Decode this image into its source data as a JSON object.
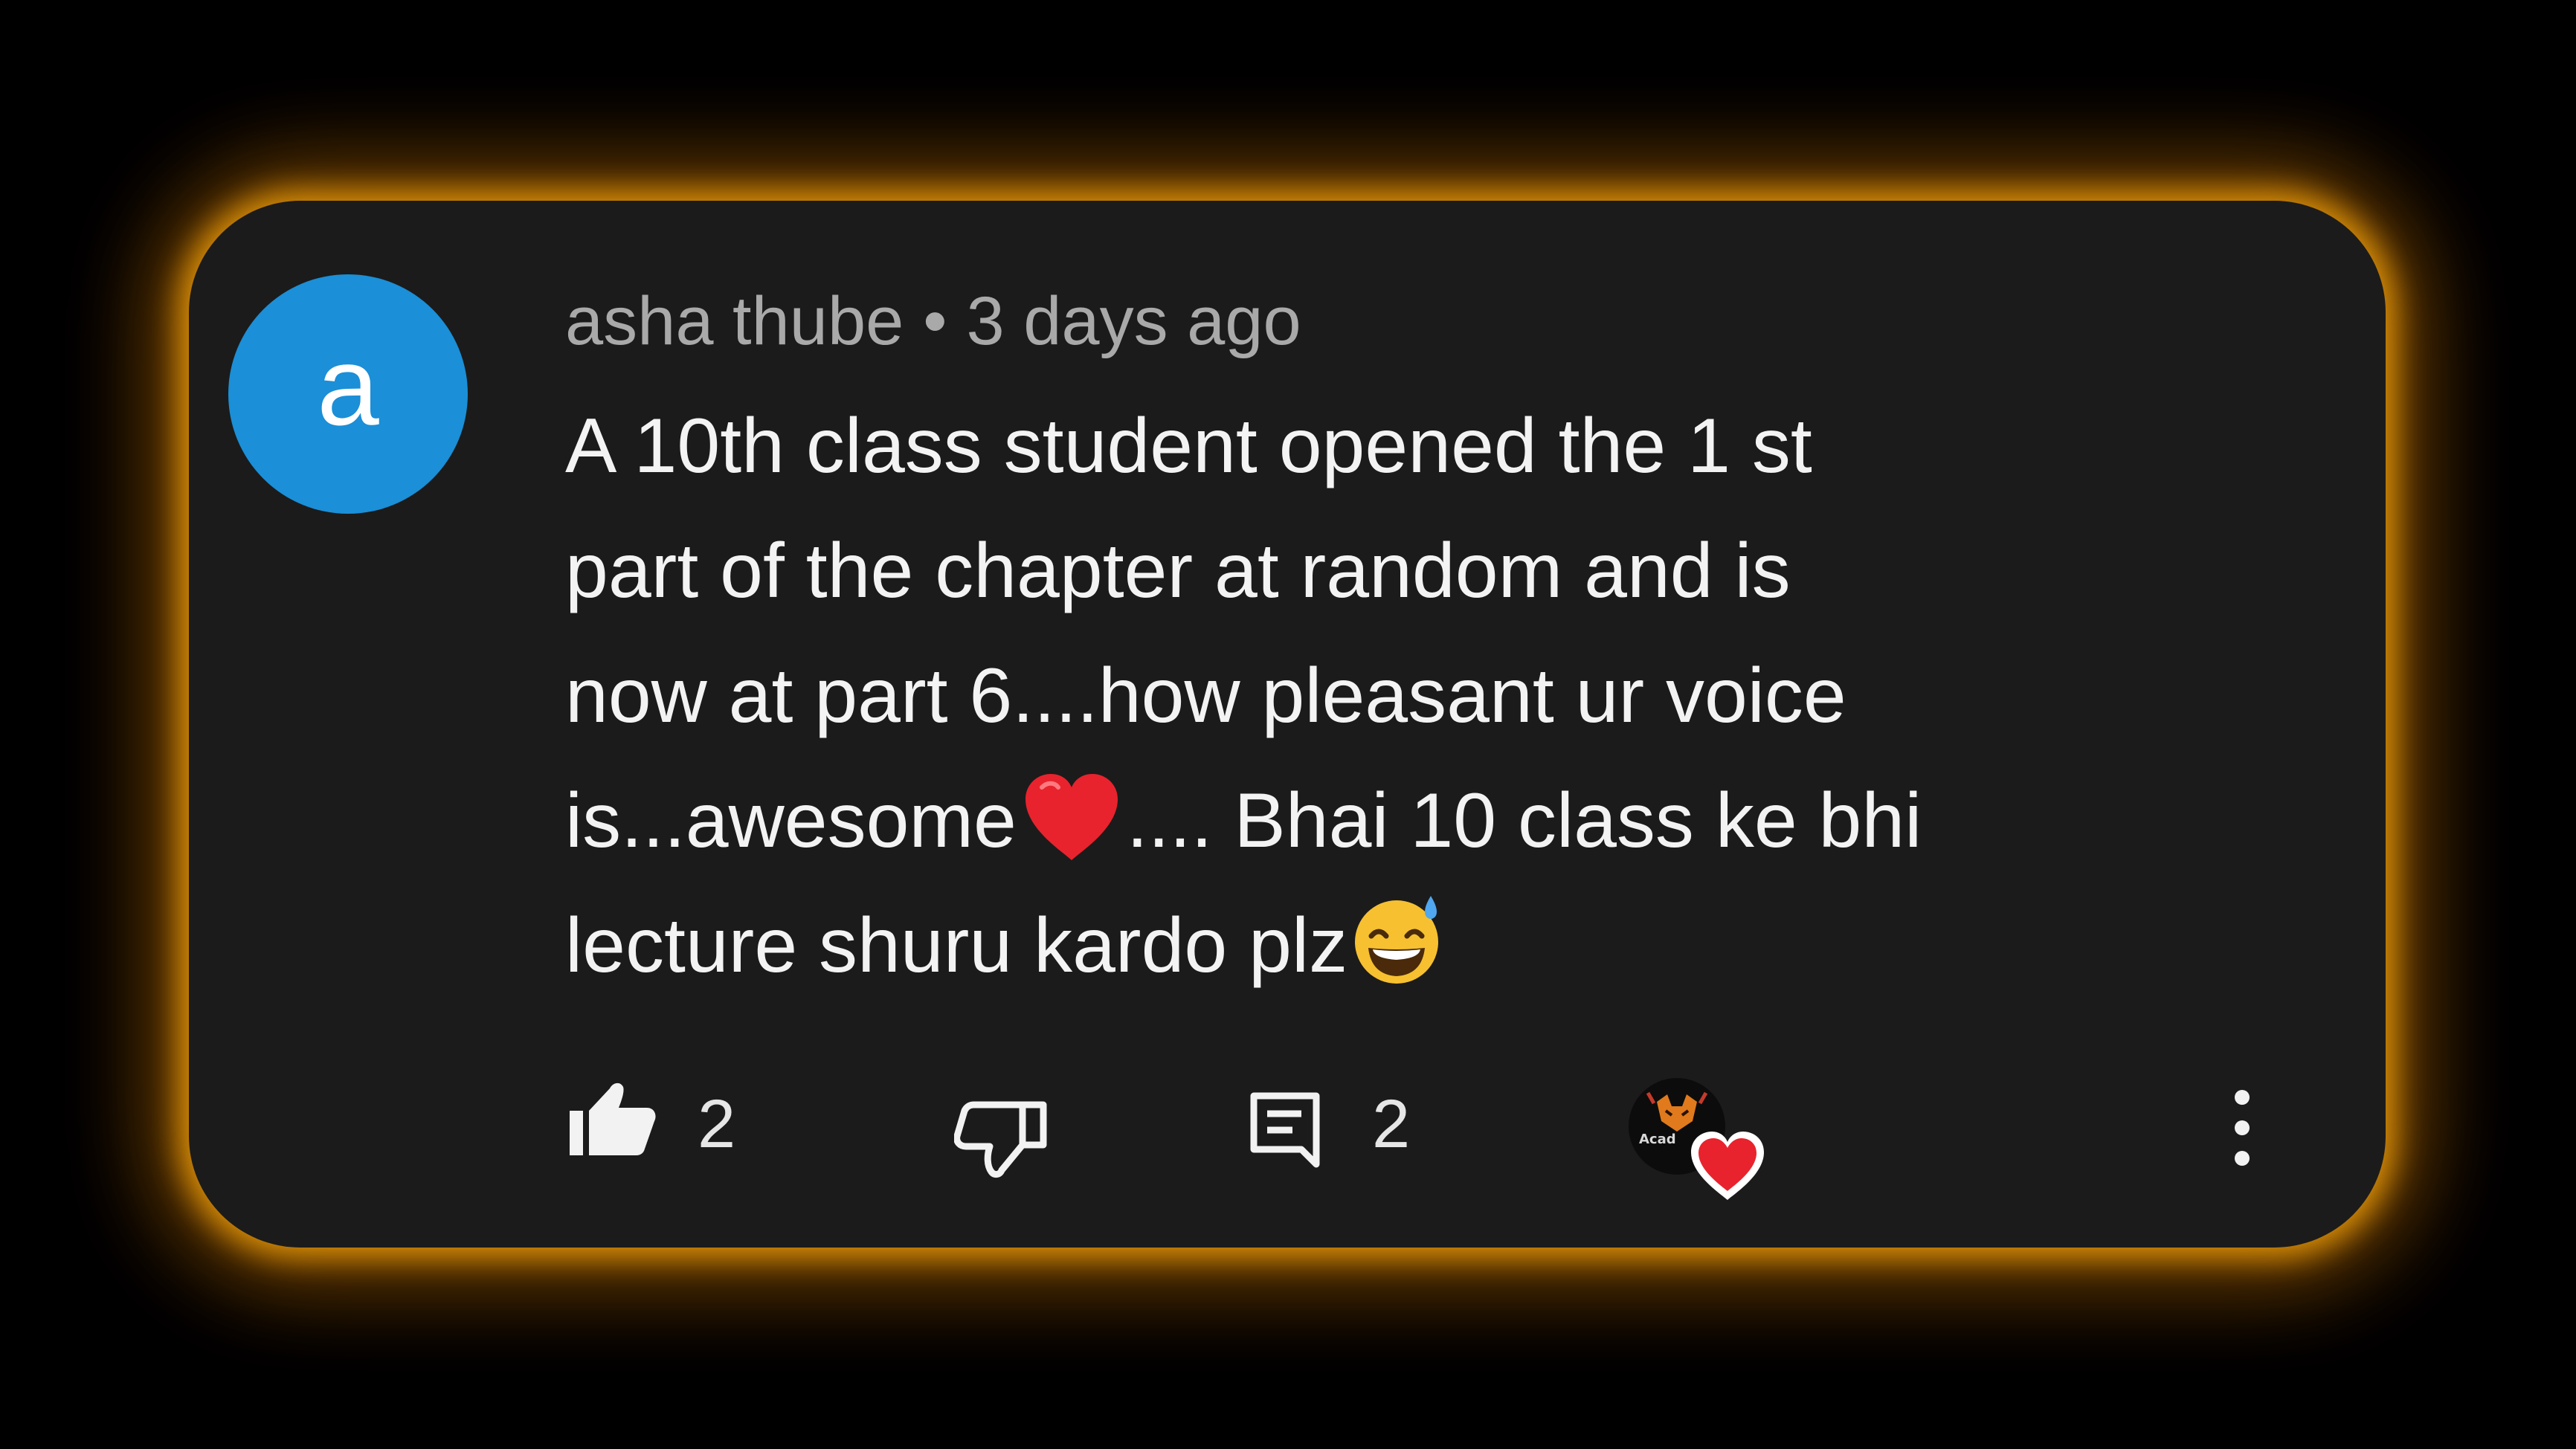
{
  "comment": {
    "avatar_letter": "a",
    "author": "asha thube",
    "separator": "•",
    "time": "3 days ago",
    "text_lines": [
      "A 10th class student opened the 1 st",
      "part of the chapter at random and is",
      "now at part 6....how pleasant ur voice",
      "is...awesome",
      ".... Bhai 10 class ke bhi",
      "lecture shuru kardo plz"
    ]
  },
  "actions": {
    "like_count": "2",
    "reply_count": "2",
    "creator_avatar_text": "Acad"
  },
  "icons": {
    "like": "thumbs-up-icon",
    "dislike": "thumbs-down-icon",
    "reply": "reply-comment-icon",
    "heart": "heart-icon",
    "more": "more-vertical-icon",
    "emoji_heart": "red-heart-emoji",
    "emoji_smile": "grinning-sweat-emoji"
  },
  "colors": {
    "glow": "#e0940a",
    "card_bg": "#1b1b1b",
    "avatar_bg": "#1b8fd7",
    "heart_red": "#e8232d"
  }
}
